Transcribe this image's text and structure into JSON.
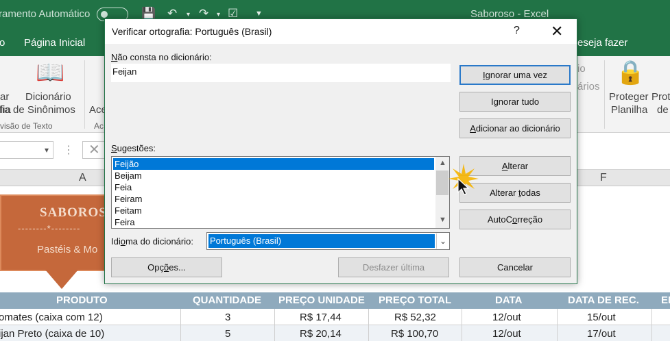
{
  "excel": {
    "autosave_label": "ramento Automático",
    "doc_title": "Saboroso  -  Excel",
    "menu": {
      "left": "o",
      "home_tab": "Página Inicial",
      "tell_me": "eseja fazer"
    },
    "ribbon": {
      "thesaurus_top": "Dicionário",
      "thesaurus_bottom": "fia de Sinônimos",
      "left_fragment_top": "ar",
      "left_fragment_bottom": "fia",
      "left_group": "visão de Texto",
      "ace": "Ace",
      "ac_group": "Ac",
      "io": "io",
      "arios": "ários",
      "protect_sheet_top": "Proteger",
      "protect_sheet_bottom": "Planilha",
      "protect_wb_top": "Prot",
      "protect_wb_bottom": "de"
    },
    "columns": {
      "a": "A",
      "f": "F"
    },
    "logo": {
      "name": "SABOROSO",
      "stars": "--------*--------",
      "tagline": "Pastéis & Mo"
    },
    "table": {
      "headers": [
        "PRODUTO",
        "QUANTIDADE",
        "PREÇO UNIDADE",
        "PREÇO TOTAL",
        "DATA",
        "DATA DE REC.",
        "EN"
      ],
      "rows": [
        [
          "omates (caixa com 12)",
          "3",
          "R$ 17,44",
          "R$ 52,32",
          "12/out",
          "15/out"
        ],
        [
          "ijan Preto (caixa de 10)",
          "5",
          "R$ 20,14",
          "R$ 100,70",
          "12/out",
          "17/out"
        ]
      ]
    }
  },
  "dialog": {
    "title": "Verificar ortografia: Português (Brasil)",
    "help": "?",
    "close": "✕",
    "not_in_dict_label": "ão consta no dicionário:",
    "not_in_dict_key": "N",
    "not_in_dict_value": "Feijan",
    "suggestions_label": "ugestões:",
    "suggestions_key": "S",
    "suggestions": [
      "Feijão",
      "Beijam",
      "Feia",
      "Feiram",
      "Feitam",
      "Feira"
    ],
    "selected_suggestion_index": 0,
    "language_label_pre": "Idi",
    "language_label_key": "o",
    "language_label_post": "ma do dicionário:",
    "language_value": "Português (Brasil)",
    "buttons": {
      "ignore_once": {
        "pre": "",
        "key": "I",
        "post": "gnorar uma vez"
      },
      "ignore_all": {
        "pre": "I",
        "key": "g",
        "post": "norar tudo"
      },
      "add_to_dict": {
        "pre": "",
        "key": "A",
        "post": "dicionar ao dicionário"
      },
      "change": {
        "pre": "",
        "key": "A",
        "post": "lterar"
      },
      "change_all": {
        "pre": "Alterar ",
        "key": "t",
        "post": "odas"
      },
      "autocorrect": {
        "pre": "AutoC",
        "key": "o",
        "post": "rreção"
      },
      "options": {
        "pre": "Opç",
        "key": "õ",
        "post": "es..."
      },
      "undo_last": "Desfazer última",
      "cancel": "Cancelar"
    }
  }
}
